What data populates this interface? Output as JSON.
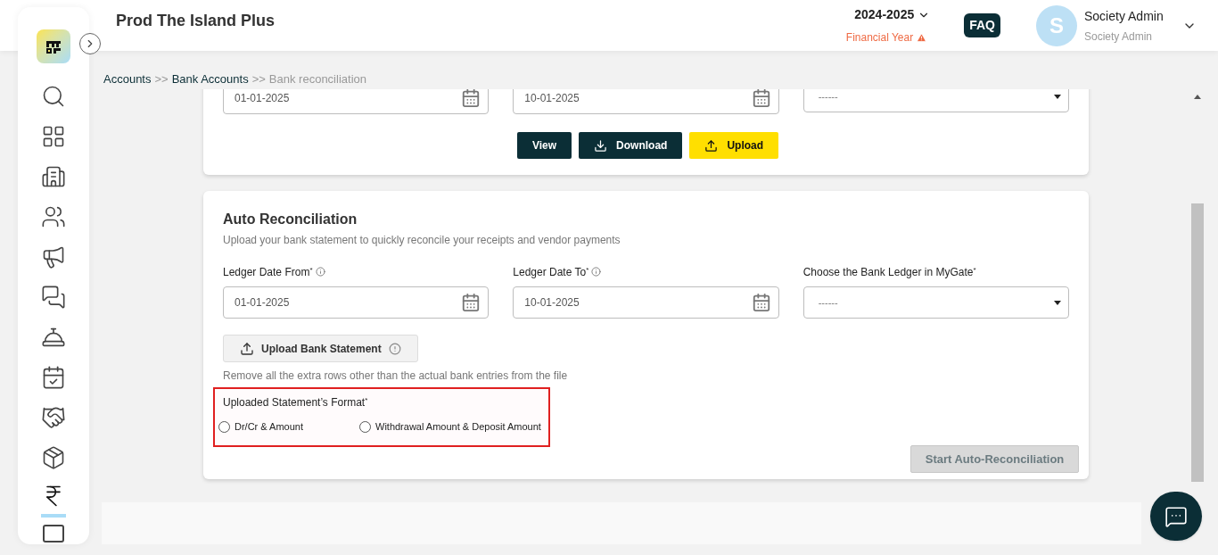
{
  "header": {
    "title": "Prod The Island Plus",
    "year": "2024-2025",
    "year_caption": "Financial Year",
    "faq": "FAQ",
    "avatar_letter": "S",
    "user_name": "Society Admin",
    "user_role": "Society Admin"
  },
  "nav_items": [
    {
      "kind": "search",
      "selected": false
    },
    {
      "kind": "grid",
      "selected": false
    },
    {
      "kind": "building",
      "selected": false
    },
    {
      "kind": "people",
      "selected": false
    },
    {
      "kind": "megaphone",
      "selected": false
    },
    {
      "kind": "chat",
      "selected": false
    },
    {
      "kind": "desk",
      "selected": false
    },
    {
      "kind": "calendar",
      "selected": false
    },
    {
      "kind": "handshake",
      "selected": false
    },
    {
      "kind": "box",
      "selected": false
    },
    {
      "kind": "rupee",
      "selected": true
    }
  ],
  "breadcrumb": [
    {
      "label": "Accounts",
      "current": false
    },
    {
      "label": "Bank Accounts",
      "current": false
    },
    {
      "label": "Bank reconciliation",
      "current": true
    }
  ],
  "breadcrumb_separator": ">>",
  "top_card": {
    "date_from": "01-01-2025",
    "date_to": "10-01-2025",
    "ledger": "------",
    "buttons": [
      {
        "label": "View",
        "kind": "dark"
      },
      {
        "label": "Download",
        "kind": "download"
      },
      {
        "label": "Upload",
        "kind": "upload"
      }
    ]
  },
  "auto_reconciliation": {
    "title": "Auto Reconciliation",
    "subtitle": "Upload your bank statement to quickly reconcile your receipts and vendor payments",
    "fields": [
      {
        "label": "Ledger Date From",
        "kind": "date",
        "value": "01-01-2025",
        "info": true
      },
      {
        "label": "Ledger Date To",
        "kind": "date",
        "value": "10-01-2025",
        "info": true
      },
      {
        "label": "Choose the Bank Ledger in MyGate",
        "kind": "select",
        "value": "------",
        "info": false
      }
    ],
    "required_mark": "*",
    "upload_button": "Upload Bank Statement",
    "upload_hint": "Remove all the extra rows other than the actual bank entries from the file",
    "format_label": "Uploaded Statement’s Format",
    "format_options": [
      {
        "label": "Dr/Cr & Amount",
        "selected": false
      },
      {
        "label": "Withdrawal Amount & Deposit Amount",
        "selected": false
      }
    ],
    "start_button": {
      "label": "Start Auto-Reconciliation",
      "disabled": true
    }
  }
}
